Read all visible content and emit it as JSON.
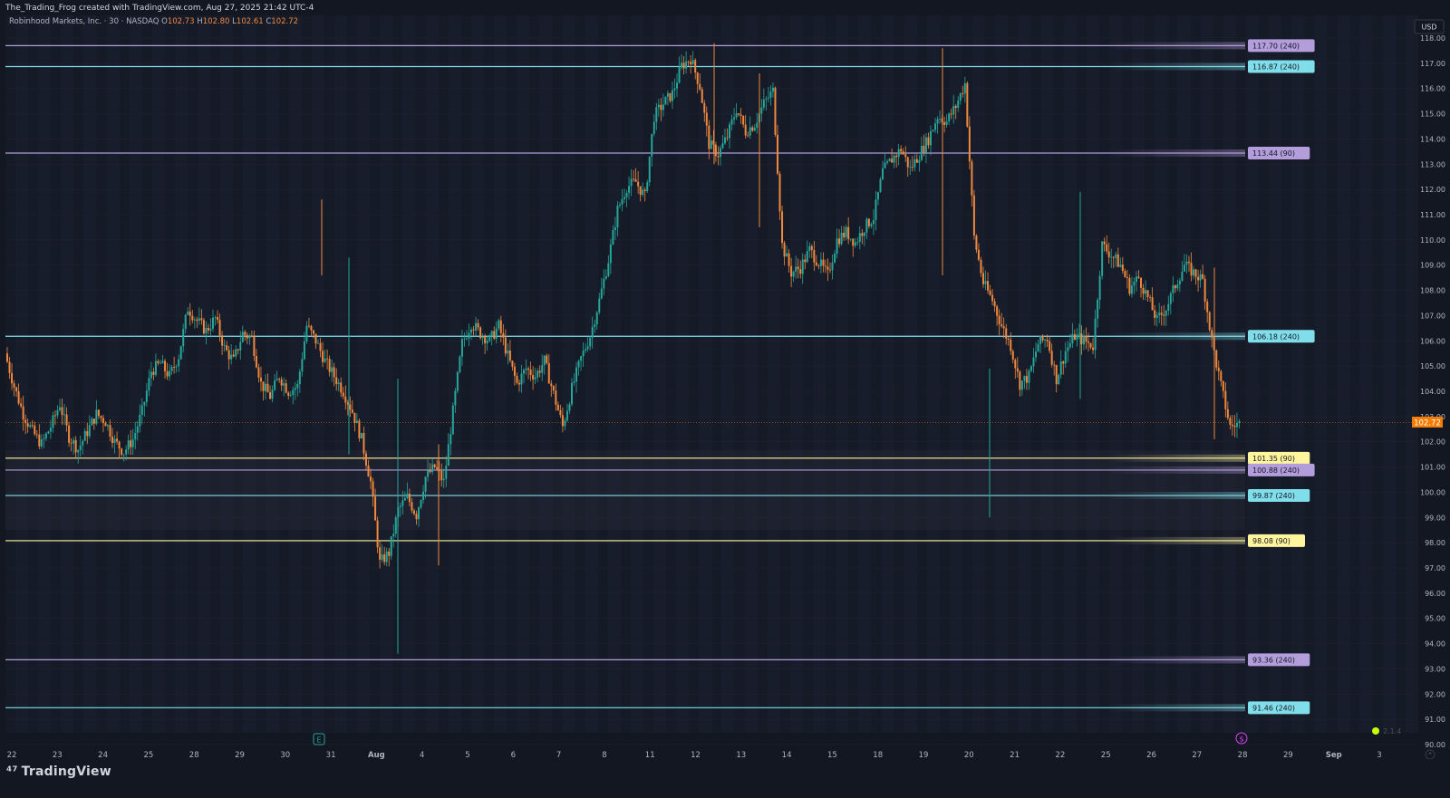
{
  "header": {
    "caption": "The_Trading_Frog created with TradingView.com, Aug 27, 2025 21:42 UTC-4"
  },
  "symbol_bar": {
    "name": "Robinhood Markets, Inc. · 30 · NASDAQ",
    "o_label": "O",
    "o_value": "102.73",
    "h_label": "H",
    "h_value": "102.80",
    "l_label": "L",
    "l_value": "102.61",
    "c_label": "C",
    "c_value": "102.72"
  },
  "currency_button": "USD",
  "footer": {
    "brand": "TradingView",
    "version": "2.1.4"
  },
  "colors": {
    "background": "#131722",
    "candle_up": "#26a69a",
    "candle_down": "#f0883e",
    "level_purple": "#b39ddb",
    "level_cyan": "#80deea",
    "level_yellow": "#fff59d",
    "price_tag": "#f57c00"
  },
  "chart_data": {
    "type": "candlestick",
    "title": "Robinhood Markets, Inc. · 30 · NASDAQ",
    "y_axis": {
      "ticks": [
        "118.00",
        "117.00",
        "116.00",
        "115.00",
        "114.00",
        "113.00",
        "112.00",
        "111.00",
        "110.00",
        "109.00",
        "108.00",
        "107.00",
        "106.00",
        "105.00",
        "104.00",
        "103.00",
        "102.00",
        "101.00",
        "100.00",
        "99.00",
        "98.00",
        "97.00",
        "96.00",
        "95.00",
        "94.00",
        "93.00",
        "92.00",
        "91.00",
        "90.00"
      ],
      "range": [
        90,
        118.2
      ],
      "side": "right"
    },
    "x_axis": {
      "ticks": [
        "22",
        "23",
        "24",
        "25",
        "28",
        "29",
        "30",
        "31",
        "Aug",
        "4",
        "5",
        "6",
        "7",
        "8",
        "11",
        "12",
        "13",
        "14",
        "15",
        "18",
        "19",
        "20",
        "21",
        "22",
        "25",
        "26",
        "27",
        "28",
        "29",
        "Sep",
        "3"
      ]
    },
    "current_price": {
      "value": 102.72,
      "label": "102.72"
    },
    "levels": [
      {
        "value": 117.7,
        "label": "117.70 (240)",
        "color": "purple"
      },
      {
        "value": 116.87,
        "label": "116.87 (240)",
        "color": "cyan"
      },
      {
        "value": 113.44,
        "label": "113.44 (90)",
        "color": "purple"
      },
      {
        "value": 106.18,
        "label": "106.18 (240)",
        "color": "cyan"
      },
      {
        "value": 101.35,
        "label": "101.35 (90)",
        "color": "yellow"
      },
      {
        "value": 100.88,
        "label": "100.88 (240)",
        "color": "purple"
      },
      {
        "value": 99.87,
        "label": "99.87 (240)",
        "color": "cyan"
      },
      {
        "value": 98.08,
        "label": "98.08 (90)",
        "color": "yellow"
      },
      {
        "value": 93.36,
        "label": "93.36 (240)",
        "color": "purple"
      },
      {
        "value": 91.46,
        "label": "91.46 (240)",
        "color": "cyan"
      }
    ],
    "series": [
      {
        "values": [
          105.5,
          104.2,
          103.1,
          102.4,
          101.9,
          102.6,
          103.5,
          102.2,
          101.7,
          102.4,
          103.1,
          102.8,
          102.0,
          101.6,
          102.1,
          103.2,
          104.8,
          105.1,
          104.6,
          105.4,
          107.3,
          106.8,
          106.4,
          106.9,
          105.7,
          105.2,
          106.3,
          106.1,
          104.3,
          103.8,
          104.6,
          104.0,
          104.2,
          106.6,
          106.0,
          105.2,
          104.6,
          104.0,
          103.2,
          102.1,
          100.4,
          97.2,
          97.6,
          99.3,
          99.8,
          99.1,
          100.6,
          101.0,
          100.4,
          103.2,
          105.9,
          106.7,
          106.3,
          106.0,
          106.6,
          105.4,
          104.3,
          104.9,
          104.6,
          105.2,
          103.9,
          102.6,
          104.1,
          105.3,
          106.2,
          107.6,
          109.2,
          111.2,
          112.1,
          112.3,
          111.7,
          114.9,
          115.4,
          115.8,
          116.9,
          117.2,
          116.1,
          113.8,
          113.4,
          114.1,
          115.2,
          114.3,
          114.6,
          115.4,
          115.9,
          109.8,
          108.7,
          108.9,
          109.6,
          109.1,
          108.6,
          110.0,
          110.3,
          109.9,
          110.5,
          110.9,
          112.7,
          113.2,
          113.6,
          112.8,
          113.4,
          114.0,
          114.9,
          114.7,
          115.3,
          116.2,
          110.1,
          108.3,
          107.6,
          106.6,
          105.8,
          104.3,
          104.6,
          105.9,
          106.1,
          104.5,
          105.6,
          106.2,
          106.0,
          105.8,
          109.8,
          109.4,
          109.0,
          108.1,
          108.5,
          107.7,
          106.8,
          107.3,
          108.2,
          109.0,
          108.7,
          108.4,
          106.0,
          104.2,
          102.6,
          102.72
        ]
      }
    ]
  }
}
